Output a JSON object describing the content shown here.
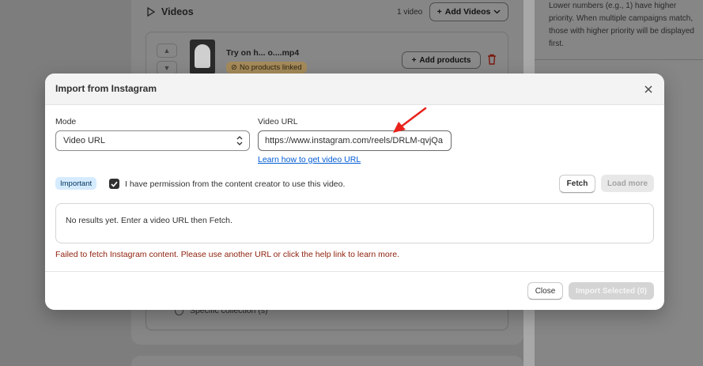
{
  "background": {
    "videos_title": "Videos",
    "video_count": "1 video",
    "add_videos_label": "Add Videos",
    "file_name": "Try on h... o....mp4",
    "no_products_badge": "No products linked",
    "add_products_label": "Add products",
    "right_panel_text": "Lower numbers (e.g., 1) have higher priority. When multiple campaigns match, those with higher priority will be displayed first.",
    "collection_option": "Specific collection (s)"
  },
  "modal": {
    "title": "Import from Instagram",
    "mode_label": "Mode",
    "mode_value": "Video URL",
    "video_url_label": "Video URL",
    "video_url_value": "https://www.instagram.com/reels/DRLM-qvjQa",
    "help_link": "Learn how to get video URL",
    "important_badge": "Important",
    "permission_label": "I have permission from the content creator to use this video.",
    "permission_checked": true,
    "fetch_label": "Fetch",
    "load_more_label": "Load more",
    "results_empty": "No results yet. Enter a video URL then Fetch.",
    "error_message": "Failed to fetch Instagram content. Please use another URL or click the help link to learn more.",
    "close_label": "Close",
    "import_label": "Import Selected (0)"
  },
  "colors": {
    "link": "#005bd3",
    "error": "#8e1f0b",
    "important_badge_bg": "#d5ebff",
    "annotation_arrow": "#e8221b"
  }
}
